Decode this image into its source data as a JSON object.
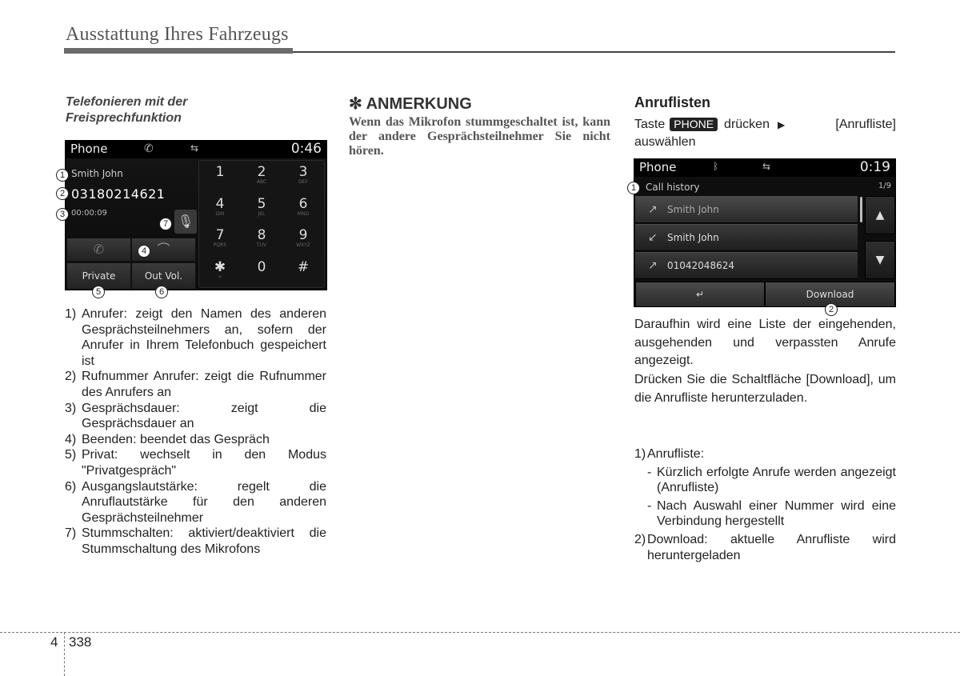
{
  "header": {
    "title": "Ausstattung Ihres Fahrzeugs"
  },
  "column1": {
    "subtitle_line1": "Telefonieren mit der",
    "subtitle_line2": "Freisprechfunktion",
    "screen": {
      "app_label": "Phone",
      "status_icons": [
        "phone-handset-icon",
        "usb-icon"
      ],
      "time": "0:46",
      "caller_name": "Smith John",
      "caller_number": "03180214621",
      "duration": "00:00:09",
      "buttons": {
        "private": "Private",
        "out_vol": "Out Vol."
      },
      "keypad": [
        {
          "digit": "1",
          "letters": ""
        },
        {
          "digit": "2",
          "letters": "ABC"
        },
        {
          "digit": "3",
          "letters": "DEF"
        },
        {
          "digit": "4",
          "letters": "GHI"
        },
        {
          "digit": "5",
          "letters": "JKL"
        },
        {
          "digit": "6",
          "letters": "MNO"
        },
        {
          "digit": "7",
          "letters": "PQRS"
        },
        {
          "digit": "8",
          "letters": "TUV"
        },
        {
          "digit": "9",
          "letters": "WXYZ"
        },
        {
          "digit": "✱",
          "letters": "+"
        },
        {
          "digit": "0",
          "letters": ""
        },
        {
          "digit": "#",
          "letters": ""
        }
      ]
    },
    "callouts": [
      "1",
      "2",
      "3",
      "4",
      "5",
      "6",
      "7"
    ],
    "list": [
      {
        "num": "1)",
        "text": "Anrufer: zeigt den Namen des anderen Gesprächsteilnehmers an, sofern der Anrufer in Ihrem Telefonbuch gespeichert ist"
      },
      {
        "num": "2)",
        "text": "Rufnummer Anrufer: zeigt die Rufnummer des Anrufers an"
      },
      {
        "num": "3)",
        "text": "Gesprächsdauer: zeigt die Gesprächsdauer an"
      },
      {
        "num": "4)",
        "text": "Beenden: beendet das Gespräch"
      },
      {
        "num": "5)",
        "text": "Privat: wechselt in den Modus \"Privatgespräch\""
      },
      {
        "num": "6)",
        "text": "Ausgangslautstärke: regelt die Anruflautstärke für den anderen Gesprächsteilnehmer"
      },
      {
        "num": "7)",
        "text": "Stummschalten: aktiviert/deaktiviert die Stummschaltung des Mikrofons"
      }
    ]
  },
  "column2": {
    "note_heading": "✻ ANMERKUNG",
    "note_body": "Wenn das Mikrofon stummgeschaltet ist, kann der andere Gesprächsteilnehmer Sie nicht hören."
  },
  "column3": {
    "title": "Anruflisten",
    "intro_pre": "Taste",
    "intro_key": "PHONE",
    "intro_mid": "drücken",
    "intro_post": "[Anrufliste]",
    "intro_end": "auswählen",
    "screen": {
      "app_label": "Phone",
      "status_icons": [
        "bluetooth-icon",
        "usb-icon"
      ],
      "time": "0:19",
      "list_title": "Call history",
      "page": "1/9",
      "rows": [
        {
          "icon": "outgoing-call-icon",
          "label": "Smith John"
        },
        {
          "icon": "incoming-call-icon",
          "label": "Smith John"
        },
        {
          "icon": "outgoing-call-icon",
          "label": "01042048624"
        }
      ],
      "download_label": "Download"
    },
    "callouts": [
      "1",
      "2"
    ],
    "para1": "Daraufhin wird eine Liste der eingehenden, ausgehenden und verpassten Anrufe angezeigt.",
    "para2": "Drücken Sie die Schaltfläche [Download], um die Anrufliste herunterzuladen.",
    "list": {
      "item1_num": "1)",
      "item1_label": "Anrufliste:",
      "item1_subs": [
        "Kürzlich erfolgte Anrufe werden angezeigt (Anrufliste)",
        "Nach Auswahl einer Nummer wird eine Verbindung hergestellt"
      ],
      "item2_num": "2)",
      "item2_text": "Download: aktuelle Anrufliste wird heruntergeladen"
    }
  },
  "footer": {
    "chapter": "4",
    "page": "338"
  }
}
